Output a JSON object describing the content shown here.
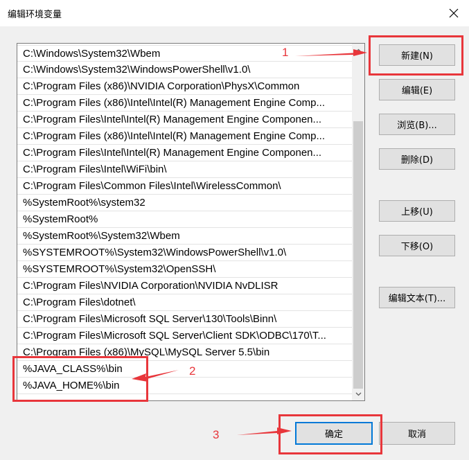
{
  "window": {
    "title": "编辑环境变量"
  },
  "path_list": {
    "entries": [
      "C:\\Windows\\System32\\Wbem",
      "C:\\Windows\\System32\\WindowsPowerShell\\v1.0\\",
      "C:\\Program Files (x86)\\NVIDIA Corporation\\PhysX\\Common",
      "C:\\Program Files (x86)\\Intel\\Intel(R) Management Engine Comp...",
      "C:\\Program Files\\Intel\\Intel(R) Management Engine Componen...",
      "C:\\Program Files (x86)\\Intel\\Intel(R) Management Engine Comp...",
      "C:\\Program Files\\Intel\\Intel(R) Management Engine Componen...",
      "C:\\Program Files\\Intel\\WiFi\\bin\\",
      "C:\\Program Files\\Common Files\\Intel\\WirelessCommon\\",
      "%SystemRoot%\\system32",
      "%SystemRoot%",
      "%SystemRoot%\\System32\\Wbem",
      "%SYSTEMROOT%\\System32\\WindowsPowerShell\\v1.0\\",
      "%SYSTEMROOT%\\System32\\OpenSSH\\",
      "C:\\Program Files\\NVIDIA Corporation\\NVIDIA NvDLISR",
      "C:\\Program Files\\dotnet\\",
      "C:\\Program Files\\Microsoft SQL Server\\130\\Tools\\Binn\\",
      "C:\\Program Files\\Microsoft SQL Server\\Client SDK\\ODBC\\170\\T...",
      "C:\\Program Files (x86)\\MySQL\\MySQL Server 5.5\\bin",
      "%JAVA_CLASS%\\bin",
      "%JAVA_HOME%\\bin"
    ]
  },
  "buttons": {
    "new": "新建(N)",
    "edit": "编辑(E)",
    "browse": "浏览(B)...",
    "delete": "删除(D)",
    "move_up": "上移(U)",
    "move_down": "下移(O)",
    "edit_text": "编辑文本(T)...",
    "ok": "确定",
    "cancel": "取消"
  },
  "annotations": {
    "step1": "1",
    "step2": "2",
    "step3": "3",
    "color": "#e8363b"
  },
  "icons": {
    "close": "close-icon",
    "scroll_up": "chevron-up-icon",
    "scroll_down": "chevron-down-icon"
  }
}
